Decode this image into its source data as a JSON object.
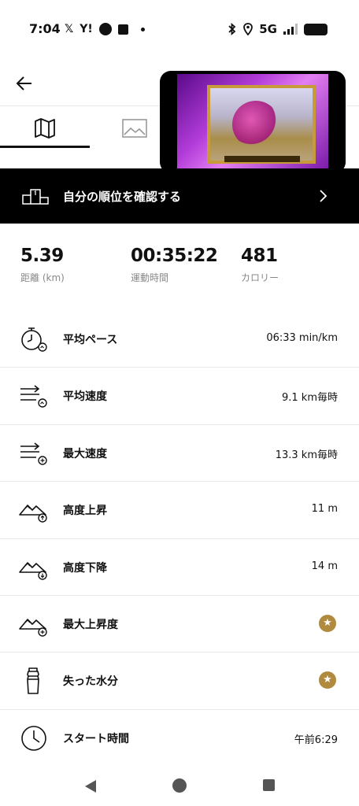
{
  "status_bar": {
    "time": "7:04",
    "x_icon": "𝕏",
    "yahoo_icon": "Y!",
    "network": "5G"
  },
  "tabs": [
    {
      "name": "map-icon",
      "selected": true
    },
    {
      "name": "image-icon",
      "selected": false
    }
  ],
  "rank_banner": {
    "label": "自分の順位を確認する"
  },
  "summary": [
    {
      "value": "5.39",
      "label": "距離 (km)"
    },
    {
      "value": "00:35:22",
      "label": "運動時間"
    },
    {
      "value": "481",
      "label": "カロリー"
    }
  ],
  "metrics": [
    {
      "icon": "stopwatch-pace-icon",
      "label": "平均ペース",
      "value": "06:33 min/km"
    },
    {
      "icon": "speed-average-icon",
      "label": "平均速度",
      "value": "9.1 km毎時"
    },
    {
      "icon": "speed-max-icon",
      "label": "最大速度",
      "value": "13.3 km毎時"
    },
    {
      "icon": "elevation-gain-icon",
      "label": "高度上昇",
      "value": "11 m"
    },
    {
      "icon": "elevation-loss-icon",
      "label": "高度下降",
      "value": "14 m"
    },
    {
      "icon": "max-elevation-icon",
      "label": "最大上昇度",
      "value": "★"
    },
    {
      "icon": "water-bottle-icon",
      "label": "失った水分",
      "value": "★"
    },
    {
      "icon": "clock-icon",
      "label": "スタート時間",
      "value": "午前6:29"
    }
  ],
  "colors": {
    "banner_bg": "#000000",
    "premium_badge": "#b08a3e",
    "divider": "#e9e9e9"
  }
}
